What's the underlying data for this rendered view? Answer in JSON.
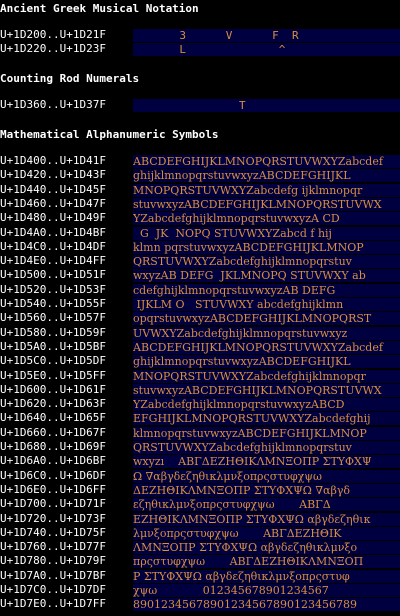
{
  "sections": [
    {
      "title": "Ancient Greek Musical Notation",
      "rows": [
        {
          "range": "U+1D200..U+1D21F",
          "glyphs": "       3      V      F  R"
        },
        {
          "range": "U+1D220..U+1D23F",
          "glyphs": "       L              ^"
        }
      ]
    },
    {
      "title": "Counting Rod Numerals",
      "rows": [
        {
          "range": "U+1D360..U+1D37F",
          "glyphs": "                T"
        }
      ]
    },
    {
      "title": "Mathematical Alphanumeric Symbols",
      "rows": [
        {
          "range": "U+1D400..U+1D41F",
          "glyphs": "ABCDEFGHIJKLMNOPQRSTUVWXYZabcdef"
        },
        {
          "range": "U+1D420..U+1D43F",
          "glyphs": "ghijklmnopqrstuvwxyzABCDEFGHIJKL"
        },
        {
          "range": "U+1D440..U+1D45F",
          "glyphs": "MNOPQRSTUVWXYZabcdefg ijklmnopqr"
        },
        {
          "range": "U+1D460..U+1D47F",
          "glyphs": "stuvwxyzABCDEFGHIJKLMNOPQRSTUVWX"
        },
        {
          "range": "U+1D480..U+1D49F",
          "glyphs": "YZabcdefghijklmnopqrstuvwxyzA CD"
        },
        {
          "range": "U+1D4A0..U+1D4BF",
          "glyphs": "  G  JK  NOPQ STUVWXYZabcd f hij"
        },
        {
          "range": "U+1D4C0..U+1D4DF",
          "glyphs": "klmn pqrstuvwxyzABCDEFGHIJKLMNOP"
        },
        {
          "range": "U+1D4E0..U+1D4FF",
          "glyphs": "QRSTUVWXYZabcdefghijklmnopqrstuv"
        },
        {
          "range": "U+1D500..U+1D51F",
          "glyphs": "wxyzAB DEFG  JKLMNOPQ STUVWXY ab"
        },
        {
          "range": "U+1D520..U+1D53F",
          "glyphs": "cdefghijklmnopqrstuvwxyzAB DEFG"
        },
        {
          "range": "U+1D540..U+1D55F",
          "glyphs": " IJKLM O   STUVWXY abcdefghijklmn"
        },
        {
          "range": "U+1D560..U+1D57F",
          "glyphs": "opqrstuvwxyzABCDEFGHIJKLMNOPQRST"
        },
        {
          "range": "U+1D580..U+1D59F",
          "glyphs": "UVWXYZabcdefghijklmnopqrstuvwxyz"
        },
        {
          "range": "U+1D5A0..U+1D5BF",
          "glyphs": "ABCDEFGHIJKLMNOPQRSTUVWXYZabcdef"
        },
        {
          "range": "U+1D5C0..U+1D5DF",
          "glyphs": "ghijklmnopqrstuvwxyzABCDEFGHIJKL"
        },
        {
          "range": "U+1D5E0..U+1D5FF",
          "glyphs": "MNOPQRSTUVWXYZabcdefghijklmnopqr"
        },
        {
          "range": "U+1D600..U+1D61F",
          "glyphs": "stuvwxyzABCDEFGHIJKLMNOPQRSTUVWX"
        },
        {
          "range": "U+1D620..U+1D63F",
          "glyphs": "YZabcdefghijklmnopqrstuvwxyzABCD"
        },
        {
          "range": "U+1D640..U+1D65F",
          "glyphs": "EFGHIJKLMNOPQRSTUVWXYZabcdefghij"
        },
        {
          "range": "U+1D660..U+1D67F",
          "glyphs": "klmnopqrstuvwxyzABCDEFGHIJKLMNOP"
        },
        {
          "range": "U+1D680..U+1D69F",
          "glyphs": "QRSTUVWXYZabcdefghijklmnopqrstuv"
        },
        {
          "range": "U+1D6A0..U+1D6BF",
          "glyphs": "wxyzı    ΑΒΓΔΕΖΗΘΙΚΛΜΝΞΟΠΡ ΣΤΥΦΧΨ"
        },
        {
          "range": "U+1D6C0..U+1D6DF",
          "glyphs": "Ω ∇αβγδεζηθικλμνξοπρςστυφχψω"
        },
        {
          "range": "U+1D6E0..U+1D6FF",
          "glyphs": "ΔΕΖΗΘΙΚΛΜΝΞΟΠΡ ΣΤΥΦΧΨΩ ∇αβγδ"
        },
        {
          "range": "U+1D700..U+1D71F",
          "glyphs": "εζηθικλμνξοπρςστυφχψω       ΑΒΓΔ"
        },
        {
          "range": "U+1D720..U+1D73F",
          "glyphs": "ΕΖΗΘΙΚΛΜΝΞΟΠΡ ΣΤΥΦΧΨΩ αβγδεζηθικ"
        },
        {
          "range": "U+1D740..U+1D75F",
          "glyphs": "λμνξοπρςστυφχψω       ΑΒΓΔΕΖΗΘΙΚ"
        },
        {
          "range": "U+1D760..U+1D77F",
          "glyphs": "ΛΜΝΞΟΠΡ ΣΤΥΦΧΨΩ αβγδεζηθικλμνξο"
        },
        {
          "range": "U+1D780..U+1D79F",
          "glyphs": "πρςστυφχψω       ΑΒΓΔΕΖΗΘΙΚΛΜΝΞΟΠ"
        },
        {
          "range": "U+1D7A0..U+1D7BF",
          "glyphs": "Ρ ΣΤΥΦΧΨΩ αβγδεζηθικλμνξοπρςστυφ"
        },
        {
          "range": "U+1D7C0..U+1D7DF",
          "glyphs": "χψω             012345678901234567"
        },
        {
          "range": "U+1D7E0..U+1D7FF",
          "glyphs": "89012345678901234567890123456789"
        }
      ]
    }
  ],
  "colors": {
    "background": "#000000",
    "text": "#ffffff",
    "glyph": "#d88f3e",
    "glyph_background": "#000040"
  }
}
